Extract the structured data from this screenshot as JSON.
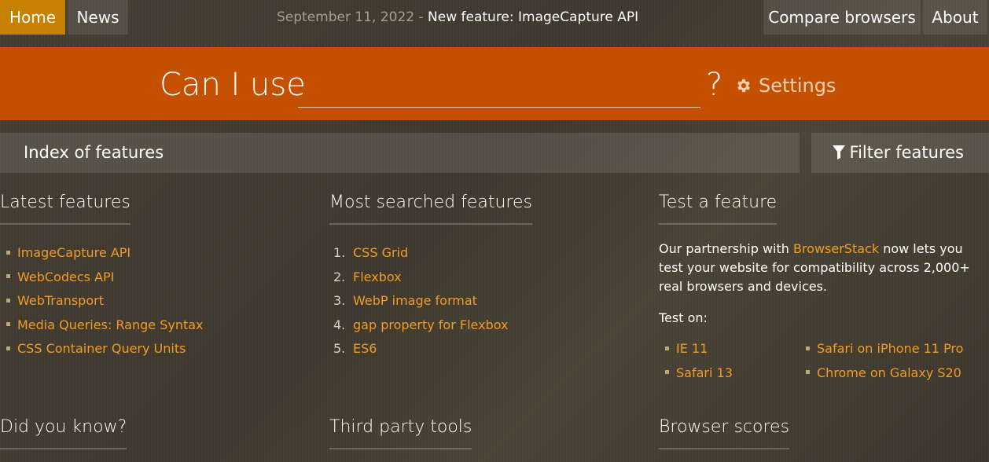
{
  "nav": {
    "home": "Home",
    "news": "News",
    "compare": "Compare browsers",
    "about": "About"
  },
  "announcement": {
    "date": "September 11, 2022",
    "separator": "-",
    "feature": "New feature: ImageCapture API"
  },
  "search": {
    "prefix": "Can I use",
    "value": "",
    "suffix": "?",
    "settings_label": "Settings"
  },
  "index": {
    "title": "Index of features",
    "filter_label": "Filter features"
  },
  "latest": {
    "heading": "Latest features",
    "items": [
      "ImageCapture API",
      "WebCodecs API",
      "WebTransport",
      "Media Queries: Range Syntax",
      "CSS Container Query Units"
    ]
  },
  "most_searched": {
    "heading": "Most searched features",
    "items": [
      {
        "num": "1.",
        "label": "CSS Grid"
      },
      {
        "num": "2.",
        "label": "Flexbox"
      },
      {
        "num": "3.",
        "label": "WebP image format"
      },
      {
        "num": "4.",
        "label": "gap property for Flexbox"
      },
      {
        "num": "5.",
        "label": "ES6"
      }
    ]
  },
  "test_feature": {
    "heading": "Test a feature",
    "text_before": "Our partnership with ",
    "link": "BrowserStack",
    "text_after": " now lets you test your website for compatibility across 2,000+ real browsers and devices.",
    "test_on": "Test on:",
    "browsers_left": [
      "IE 11",
      "Safari 13"
    ],
    "browsers_right": [
      "Safari on iPhone 11 Pro",
      "Chrome on Galaxy S20"
    ]
  },
  "bottom": {
    "did_you_know": "Did you know?",
    "third_party": "Third party tools",
    "browser_scores": "Browser scores"
  },
  "colors": {
    "header_orange": "#c55100",
    "home_active": "#c68100",
    "link": "#f19c24",
    "background": "#3f3a30"
  }
}
